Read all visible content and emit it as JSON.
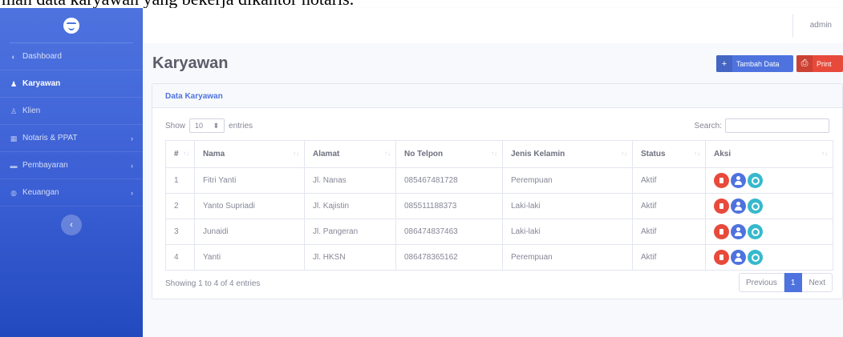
{
  "document": {
    "caption": "man data karyawan yang bekerja dikantor notaris."
  },
  "sidebar": {
    "brand_icon": "smile-logo-icon",
    "items": [
      {
        "label": "Dashboard",
        "icon": "tachometer-icon",
        "has_arrow": false
      },
      {
        "label": "Karyawan",
        "icon": "users-icon",
        "has_arrow": false,
        "active": true
      },
      {
        "label": "Klien",
        "icon": "user-plus-icon",
        "has_arrow": false
      },
      {
        "label": "Notaris & PPAT",
        "icon": "table-icon",
        "has_arrow": true
      },
      {
        "label": "Pembayaran",
        "icon": "money-icon",
        "has_arrow": true
      },
      {
        "label": "Keuangan",
        "icon": "wallet-icon",
        "has_arrow": true
      }
    ],
    "toggle_icon": "chevron-left-icon"
  },
  "topbar": {
    "user": "admin"
  },
  "page": {
    "title": "Karyawan",
    "add_button": "Tambah Data",
    "print_button": "Print"
  },
  "card": {
    "title": "Data Karyawan",
    "show_prefix": "Show",
    "show_value": "10",
    "show_suffix": "entries",
    "search_label": "Search:",
    "search_value": ""
  },
  "table": {
    "columns": [
      "#",
      "Nama",
      "Alamat",
      "No Telpon",
      "Jenis Kelamin",
      "Status",
      "Aksi"
    ],
    "rows": [
      {
        "no": "1",
        "nama": "Fitri Yanti",
        "alamat": "Jl. Nanas",
        "telpon": "085467481728",
        "jk": "Perempuan",
        "status": "Aktif"
      },
      {
        "no": "2",
        "nama": "Yanto Supriadi",
        "alamat": "Jl. Kajistin",
        "telpon": "085511188373",
        "jk": "Laki-laki",
        "status": "Aktif"
      },
      {
        "no": "3",
        "nama": "Junaidi",
        "alamat": "Jl. Pangeran",
        "telpon": "086474837463",
        "jk": "Laki-laki",
        "status": "Aktif"
      },
      {
        "no": "4",
        "nama": "Yanti",
        "alamat": "Jl. HKSN",
        "telpon": "086478365162",
        "jk": "Perempuan",
        "status": "Aktif"
      }
    ],
    "info": "Showing 1 to 4 of 4 entries"
  },
  "pagination": {
    "previous": "Previous",
    "current": "1",
    "next": "Next"
  },
  "colors": {
    "primary": "#4e73df",
    "danger": "#e74a3b",
    "info": "#36b9cc"
  }
}
